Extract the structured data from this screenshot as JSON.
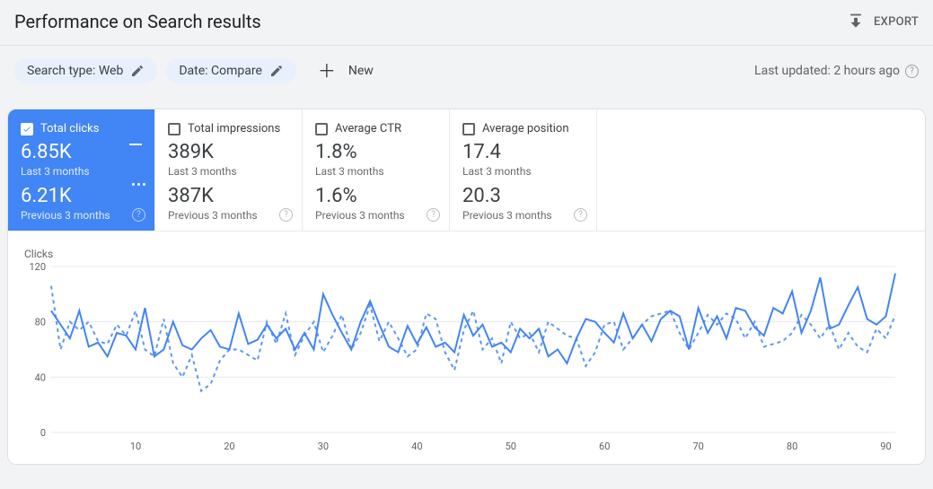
{
  "header": {
    "title": "Performance on Search results",
    "export_label": "EXPORT"
  },
  "filters": {
    "search_type_chip": "Search type: Web",
    "date_chip": "Date: Compare",
    "new_label": "New",
    "last_updated": "Last updated: 2 hours ago"
  },
  "metrics": [
    {
      "title": "Total clicks",
      "value_current": "6.85K",
      "period_current": "Last 3 months",
      "value_previous": "6.21K",
      "period_previous": "Previous 3 months",
      "active": true
    },
    {
      "title": "Total impressions",
      "value_current": "389K",
      "period_current": "Last 3 months",
      "value_previous": "387K",
      "period_previous": "Previous 3 months",
      "active": false
    },
    {
      "title": "Average CTR",
      "value_current": "1.8%",
      "period_current": "Last 3 months",
      "value_previous": "1.6%",
      "period_previous": "Previous 3 months",
      "active": false
    },
    {
      "title": "Average position",
      "value_current": "17.4",
      "period_current": "Last 3 months",
      "value_previous": "20.3",
      "period_previous": "Previous 3 months",
      "active": false
    }
  ],
  "chart_data": {
    "type": "line",
    "title": "",
    "ylabel": "Clicks",
    "xlabel": "",
    "ylim": [
      0,
      120
    ],
    "yticks": [
      0,
      40,
      80,
      120
    ],
    "xticks": [
      10,
      20,
      30,
      40,
      50,
      60,
      70,
      80,
      90
    ],
    "x": [
      1,
      2,
      3,
      4,
      5,
      6,
      7,
      8,
      9,
      10,
      11,
      12,
      13,
      14,
      15,
      16,
      17,
      18,
      19,
      20,
      21,
      22,
      23,
      24,
      25,
      26,
      27,
      28,
      29,
      30,
      31,
      32,
      33,
      34,
      35,
      36,
      37,
      38,
      39,
      40,
      41,
      42,
      43,
      44,
      45,
      46,
      47,
      48,
      49,
      50,
      51,
      52,
      53,
      54,
      55,
      56,
      57,
      58,
      59,
      60,
      61,
      62,
      63,
      64,
      65,
      66,
      67,
      68,
      69,
      70,
      71,
      72,
      73,
      74,
      75,
      76,
      77,
      78,
      79,
      80,
      81,
      82,
      83,
      84,
      85,
      86,
      87,
      88,
      89,
      90,
      91
    ],
    "series": [
      {
        "name": "Last 3 months",
        "style": "solid",
        "values": [
          88,
          78,
          68,
          88,
          62,
          65,
          55,
          72,
          70,
          60,
          90,
          55,
          60,
          80,
          63,
          60,
          68,
          74,
          62,
          60,
          86,
          64,
          67,
          78,
          68,
          75,
          60,
          72,
          60,
          100,
          85,
          72,
          60,
          80,
          95,
          78,
          62,
          58,
          77,
          64,
          76,
          62,
          65,
          58,
          85,
          70,
          78,
          62,
          65,
          58,
          75,
          68,
          75,
          55,
          60,
          50,
          68,
          82,
          80,
          72,
          65,
          86,
          68,
          78,
          66,
          82,
          88,
          84,
          60,
          90,
          72,
          84,
          68,
          90,
          88,
          76,
          70,
          90,
          86,
          102,
          72,
          88,
          112,
          75,
          78,
          92,
          105,
          82,
          78,
          84,
          115
        ]
      },
      {
        "name": "Previous 3 months",
        "style": "dashed",
        "values": [
          106,
          60,
          80,
          74,
          80,
          66,
          64,
          78,
          70,
          88,
          60,
          55,
          82,
          50,
          40,
          56,
          30,
          35,
          52,
          60,
          60,
          56,
          52,
          80,
          64,
          86,
          56,
          70,
          80,
          58,
          70,
          85,
          60,
          72,
          92,
          66,
          80,
          68,
          55,
          60,
          86,
          82,
          58,
          45,
          74,
          88,
          60,
          68,
          50,
          80,
          68,
          72,
          58,
          80,
          75,
          70,
          68,
          48,
          58,
          78,
          80,
          60,
          68,
          78,
          84,
          86,
          88,
          72,
          60,
          72,
          85,
          78,
          86,
          82,
          68,
          80,
          62,
          64,
          66,
          72,
          85,
          78,
          68,
          78,
          60,
          72,
          62,
          58,
          75,
          68,
          85
        ]
      }
    ]
  }
}
